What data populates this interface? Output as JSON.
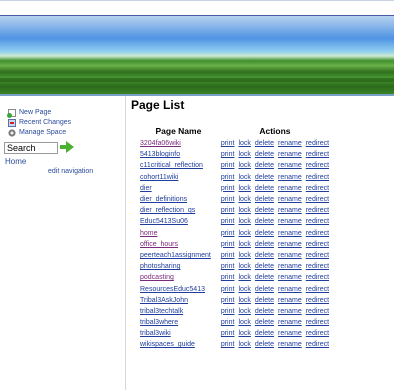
{
  "sidebar": {
    "links": [
      {
        "label": "New Page",
        "icon": "new-page-icon"
      },
      {
        "label": "Recent Changes",
        "icon": "recent-changes-icon"
      },
      {
        "label": "Manage Space",
        "icon": "gear-icon"
      }
    ],
    "search_value": "Search",
    "home_label": "Home",
    "edit_nav_label": "edit navigation"
  },
  "main": {
    "title": "Page List",
    "col_page_name": "Page Name",
    "col_actions": "Actions",
    "actions": [
      "print",
      "lock",
      "delete",
      "rename",
      "redirect"
    ],
    "pages": [
      {
        "name": "3204fa06wiki",
        "visited": true
      },
      {
        "name": "5413bloginfo",
        "visited": false
      },
      {
        "name": "c11critical_reflection",
        "visited": false
      },
      {
        "name": "cohort11wiki",
        "visited": false
      },
      {
        "name": "dier",
        "visited": false
      },
      {
        "name": "dier_definitions",
        "visited": false
      },
      {
        "name": "dier_reflection_qs",
        "visited": false
      },
      {
        "name": "Educ5413Su06",
        "visited": false
      },
      {
        "name": "home",
        "visited": true
      },
      {
        "name": "office_hours",
        "visited": true
      },
      {
        "name": "peerteach1assignment",
        "visited": false
      },
      {
        "name": "photosharing",
        "visited": false
      },
      {
        "name": "podcasting",
        "visited": true
      },
      {
        "name": "ResourcesEduc5413",
        "visited": false
      },
      {
        "name": "Tribal3AskJohn",
        "visited": false
      },
      {
        "name": "tribal3techtalk",
        "visited": false
      },
      {
        "name": "tribal3where",
        "visited": false
      },
      {
        "name": "tribal3wiki",
        "visited": false
      },
      {
        "name": "wikispaces_guide",
        "visited": false
      }
    ]
  }
}
